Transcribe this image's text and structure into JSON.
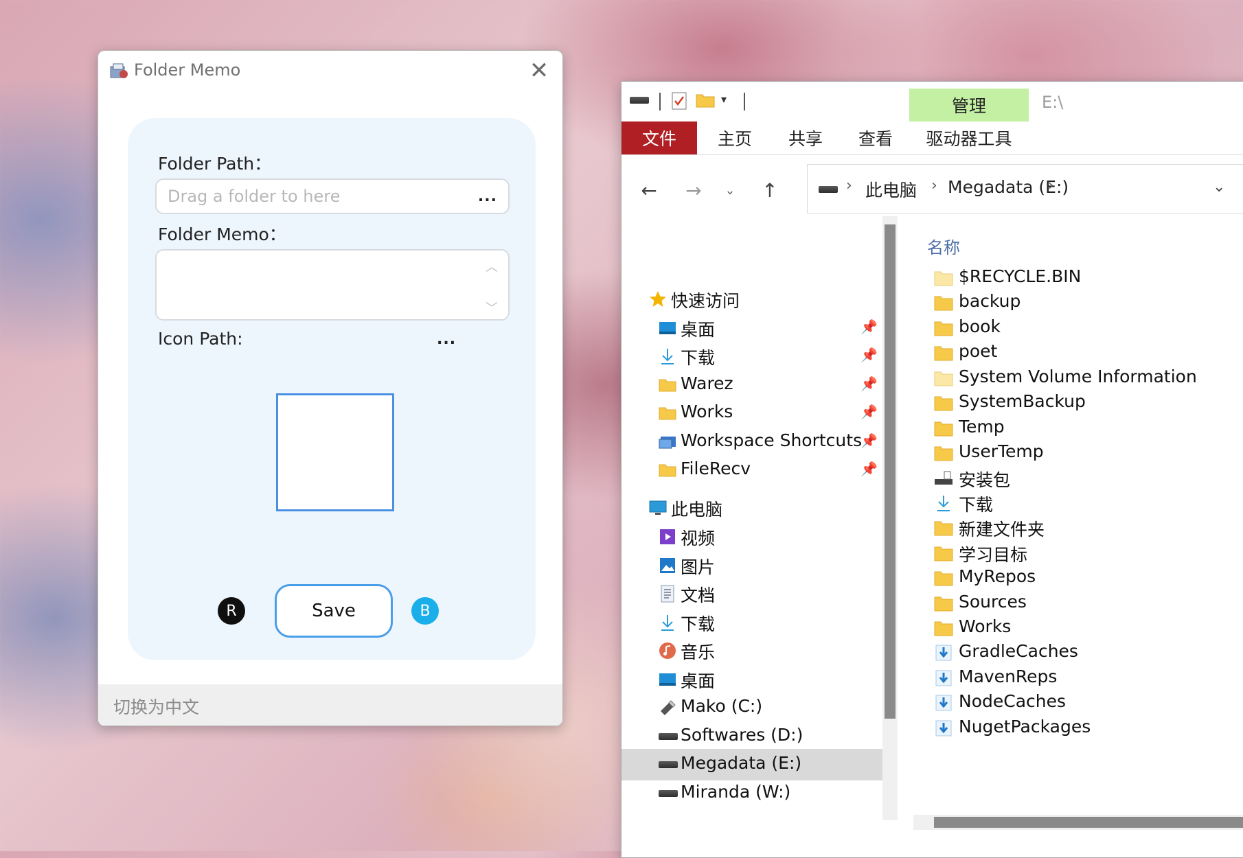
{
  "folder_memo": {
    "title": "Folder Memo",
    "close_glyph": "✕",
    "folder_path_label": "Folder Path：",
    "folder_path_placeholder": "Drag a folder to here",
    "browse_dots": "...",
    "folder_memo_label": "Folder Memo：",
    "memo_value": "",
    "icon_path_label": "Icon Path:",
    "icon_browse_dots": "...",
    "save_label": "Save",
    "r_badge": "R",
    "b_badge": "B",
    "language_toggle": "切换为中文",
    "colors": {
      "accent_blue": "#4a9ee8",
      "card_bg": "#eef6fd",
      "b_badge": "#1aaeea",
      "r_badge": "#0f0f0f"
    }
  },
  "explorer": {
    "path_title": "E:\\",
    "manage_tab": "管理",
    "tabs": [
      "文件",
      "主页",
      "共享",
      "查看",
      "驱动器工具"
    ],
    "breadcrumb": [
      "此电脑",
      "Megadata (E:)"
    ],
    "nav": {
      "quick_access": "快速访问",
      "quick_items": [
        {
          "label": "桌面",
          "icon": "desktop-icon"
        },
        {
          "label": "下载",
          "icon": "download-icon"
        },
        {
          "label": "Warez",
          "icon": "folder-icon"
        },
        {
          "label": "Works",
          "icon": "folder-icon"
        },
        {
          "label": "Workspace Shortcuts",
          "icon": "shortcuts-icon"
        },
        {
          "label": "FileRecv",
          "icon": "folder-icon"
        }
      ],
      "this_pc": "此电脑",
      "pc_items": [
        {
          "label": "视频",
          "icon": "video-icon"
        },
        {
          "label": "图片",
          "icon": "pictures-icon"
        },
        {
          "label": "文档",
          "icon": "document-icon"
        },
        {
          "label": "下载",
          "icon": "download-icon"
        },
        {
          "label": "音乐",
          "icon": "music-icon"
        },
        {
          "label": "桌面",
          "icon": "desktop-icon"
        },
        {
          "label": "Mako (C:)",
          "icon": "usb-drive-icon"
        },
        {
          "label": "Softwares (D:)",
          "icon": "drive-icon"
        },
        {
          "label": "Megadata (E:)",
          "icon": "drive-icon"
        },
        {
          "label": "Miranda (W:)",
          "icon": "drive-icon"
        }
      ],
      "selected": "Megadata (E:)"
    },
    "column_header": "名称",
    "files": [
      {
        "name": "$RECYCLE.BIN",
        "icon": "folder-light-icon"
      },
      {
        "name": "backup",
        "icon": "folder-icon"
      },
      {
        "name": "book",
        "icon": "folder-icon"
      },
      {
        "name": "poet",
        "icon": "folder-icon"
      },
      {
        "name": "System Volume Information",
        "icon": "folder-light-icon"
      },
      {
        "name": "SystemBackup",
        "icon": "folder-icon"
      },
      {
        "name": "Temp",
        "icon": "folder-icon"
      },
      {
        "name": "UserTemp",
        "icon": "folder-icon"
      },
      {
        "name": "安装包",
        "icon": "drive-folder-icon"
      },
      {
        "name": "下载",
        "icon": "download-icon"
      },
      {
        "name": "新建文件夹",
        "icon": "folder-icon"
      },
      {
        "name": "学习目标",
        "icon": "folder-icon"
      },
      {
        "name": "MyRepos",
        "icon": "folder-icon"
      },
      {
        "name": "Sources",
        "icon": "folder-icon"
      },
      {
        "name": "Works",
        "icon": "folder-icon"
      },
      {
        "name": "GradleCaches",
        "icon": "download-folder-icon"
      },
      {
        "name": "MavenReps",
        "icon": "download-folder-icon"
      },
      {
        "name": "NodeCaches",
        "icon": "download-folder-icon"
      },
      {
        "name": "NugetPackages",
        "icon": "download-folder-icon"
      }
    ],
    "colors": {
      "file_tab": "#b01f24",
      "manage_tab": "#c4f0a4",
      "folder": "#f7c948",
      "selection": "#d9d9d9"
    }
  }
}
